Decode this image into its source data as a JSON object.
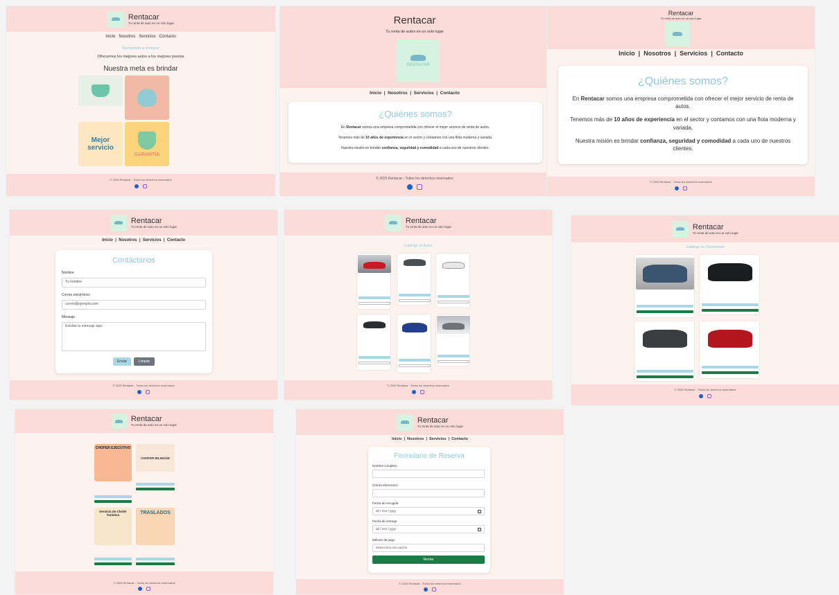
{
  "brand": {
    "name": "Rentacar",
    "tagline": "Tu renta de auto en un solo lugar",
    "tagline_alt": "Tu renta de autos en un solo lugar",
    "logo_text": "RENTACAR"
  },
  "nav": {
    "inicio": "Inicio",
    "nosotros": "Nosotros",
    "servicios": "Servicios",
    "contacto": "Contacto",
    "sep": "|"
  },
  "footer": {
    "copyright": "© 2025 Rentacar - Todos los derechos reservados"
  },
  "home": {
    "welcome": "Bienvenido a rentacar",
    "offer": "Ofrecemos los mejores autos a los mejores precios",
    "goal": "Nuestra meta es brindar",
    "tiles": [
      "Mejor servicio",
      "GARANTÍA"
    ]
  },
  "about": {
    "title": "¿Quiénes somos?",
    "p1_a": "En ",
    "p1_b": "Rentacar",
    "p1_c": " somos una empresa comprometida con ofrecer el mejor servicio de renta de autos.",
    "p2_a": "Tenemos más de ",
    "p2_b": "10 años de experiencia",
    "p2_c": " en el sector y contamos con una flota moderna y variada.",
    "p3_a": "Nuestra misión es brindar ",
    "p3_b": "confianza, seguridad y comodidad",
    "p3_c": " a cada uno de nuestros clientes."
  },
  "contact": {
    "title": "Contáctanos",
    "name_label": "Nombre",
    "name_ph": "Tu nombre",
    "email_label": "Correo electrónico",
    "email_ph": "correo@ejemplo.com",
    "msg_label": "Mensaje",
    "msg_ph": "Escribe tu mensaje aquí",
    "send": "Enviar",
    "clear": "Limpiar"
  },
  "catalog": {
    "title": "Catálogo de Autos",
    "trucks_title": "Catálogo de Camionetas"
  },
  "services": {
    "tiles": [
      "CHOFER EJECUTIVO",
      "CHOFER BILINGÜE",
      "Servicio de Chofer Turístico",
      "TRASLADOS"
    ]
  },
  "reserva": {
    "title": "Formulario de Reserva",
    "name": "Nombre completo",
    "email": "Correo electrónico",
    "pickup": "Fecha de recogida",
    "return": "Fecha de entrega",
    "date_ph": "dd / mm / yyyy",
    "payment": "Método de pago",
    "pay_ph": "Selecciona una opción",
    "submit": "Rentar"
  },
  "colors": {
    "pink": "#fcdcd8",
    "cream": "#fdf3ee",
    "accent": "#8ec8df",
    "green": "#1b7b46"
  }
}
